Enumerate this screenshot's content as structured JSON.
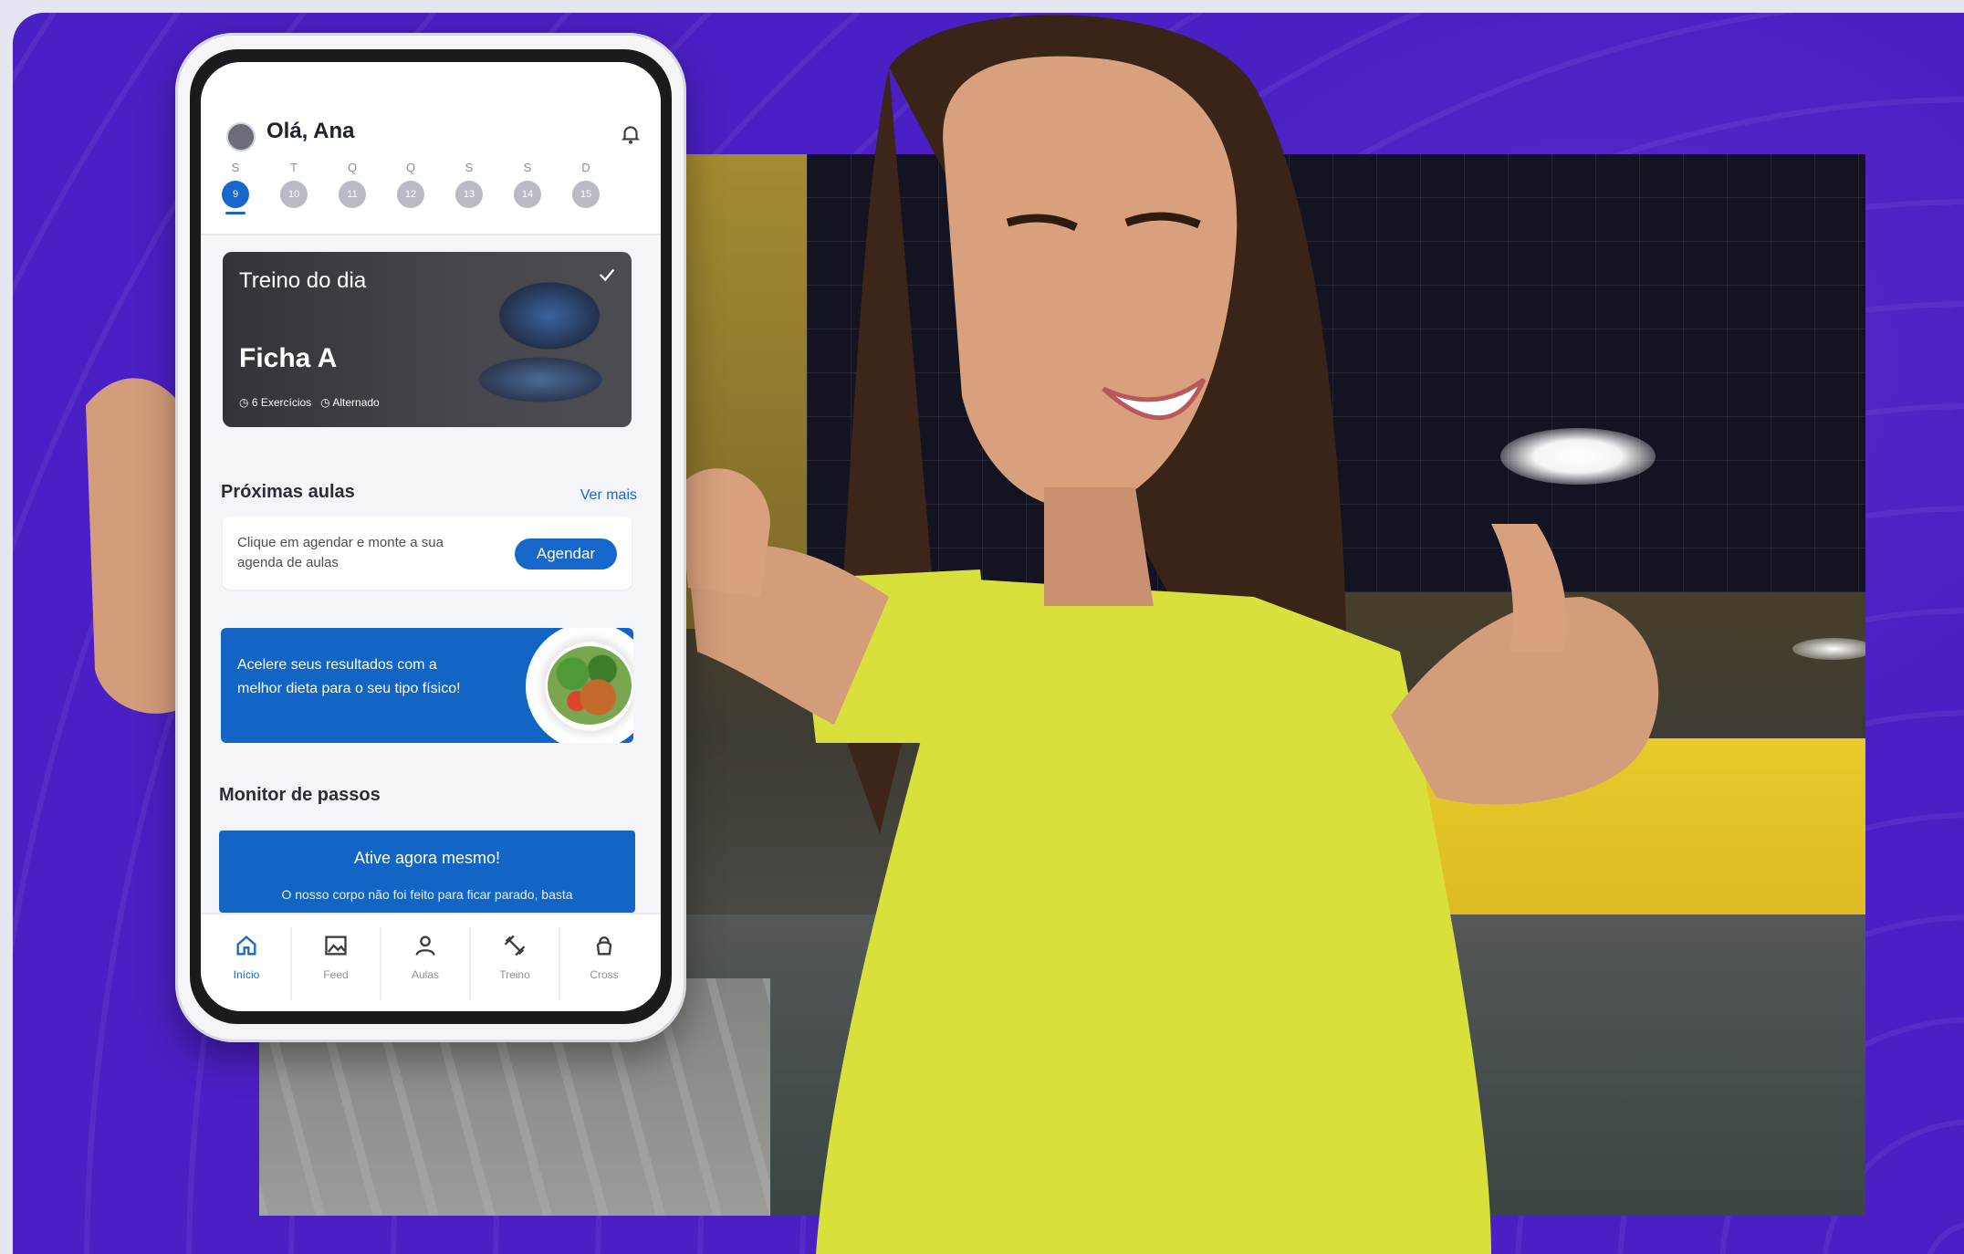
{
  "app": {
    "greeting": "Olá, Ana",
    "accent_color": "#1667c9",
    "background_color": "#4a1fc3"
  },
  "week": {
    "days": [
      {
        "name": "S",
        "date": "9",
        "active": true
      },
      {
        "name": "T",
        "date": "10",
        "active": false
      },
      {
        "name": "Q",
        "date": "11",
        "active": false
      },
      {
        "name": "Q",
        "date": "12",
        "active": false
      },
      {
        "name": "S",
        "date": "13",
        "active": false
      },
      {
        "name": "S",
        "date": "14",
        "active": false
      },
      {
        "name": "D",
        "date": "15",
        "active": false
      }
    ]
  },
  "workout": {
    "label": "Treino do dia",
    "title": "Ficha A",
    "exercises": "6 Exercícios",
    "type": "Alternado"
  },
  "classes": {
    "section_title": "Próximas aulas",
    "see_more": "Ver mais",
    "description": "Clique em agendar e monte a sua agenda de aulas",
    "button_label": "Agendar"
  },
  "promo": {
    "text": "Acelere seus resultados com a melhor dieta para o seu tipo físico!"
  },
  "steps": {
    "section_title": "Monitor de passos",
    "button_label": "Ative agora mesmo!",
    "description": "O nosso corpo não foi feito para ficar parado, basta"
  },
  "tabbar": {
    "tabs": [
      {
        "label": "Início",
        "icon": "home-icon",
        "active": true
      },
      {
        "label": "Feed",
        "icon": "image-icon",
        "active": false
      },
      {
        "label": "Aulas",
        "icon": "user-icon",
        "active": false
      },
      {
        "label": "Treino",
        "icon": "dumbbell-icon",
        "active": false
      },
      {
        "label": "Cross",
        "icon": "kettlebell-icon",
        "active": false
      }
    ]
  }
}
